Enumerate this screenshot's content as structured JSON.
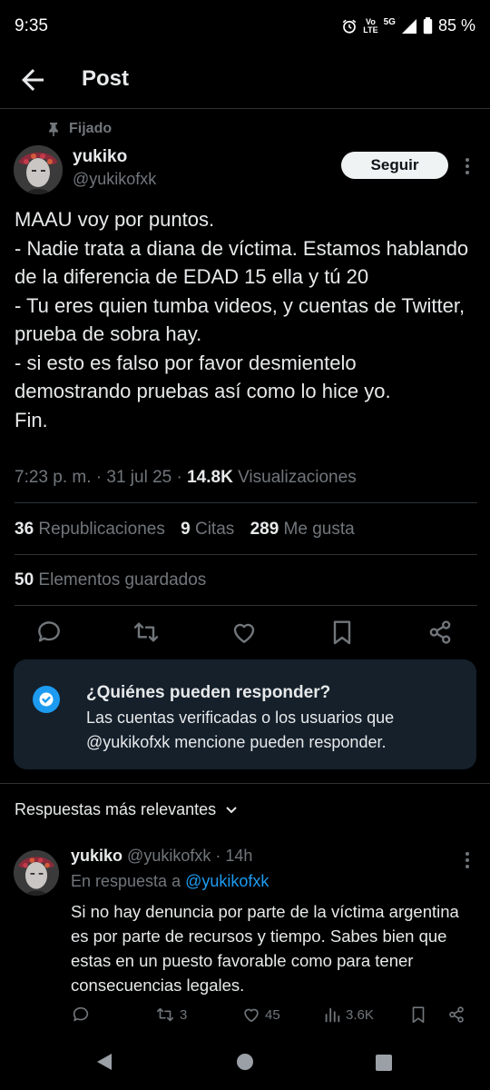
{
  "status": {
    "time": "9:35",
    "battery": "85 %",
    "network": "5G"
  },
  "header": {
    "title": "Post"
  },
  "tweet": {
    "pinned_label": "Fijado",
    "display_name": "yukiko",
    "handle": "@yukikofxk",
    "follow_label": "Seguir",
    "text": "MAAU voy por puntos.\n- Nadie trata a diana de víctima. Estamos hablando de la diferencia de EDAD 15 ella y tú 20\n- Tu eres quien tumba videos, y cuentas de Twitter, prueba de sobra hay.\n- si esto es falso por favor desmientelo demostrando pruebas así como lo hice yo.\nFin.",
    "time": "7:23 p. m. · 31 jul 25 · ",
    "views_count": "14.8K",
    "views_label": "Visualizaciones",
    "retweets_count": "36",
    "retweets_label": "Republicaciones",
    "quotes_count": "9",
    "quotes_label": "Citas",
    "likes_count": "289",
    "likes_label": "Me gusta",
    "bookmarks_count": "50",
    "bookmarks_label": "Elementos guardados"
  },
  "reply_restriction": {
    "title": "¿Quiénes pueden responder?",
    "text": "Las cuentas verificadas o los usuarios que @yukikofxk mencione pueden responder."
  },
  "sort_label": "Respuestas más relevantes",
  "reply": {
    "display_name": "yukiko",
    "handle_time": "@yukikofxk · 14h",
    "reply_to_prefix": "En respuesta a ",
    "reply_to_handle": "@yukikofxk",
    "text": "Si no hay denuncia por parte de la víctima argentina es por parte de recursos y tiempo. Sabes bien que estas en un puesto favorable como para tener consecuencias legales.",
    "retweets": "3",
    "likes": "45",
    "views": "3.6K"
  },
  "colors": {
    "accent": "#1d9bf0",
    "muted": "#71767b",
    "text": "#e7e9ea",
    "background": "#000000",
    "info_box": "#15202b"
  }
}
